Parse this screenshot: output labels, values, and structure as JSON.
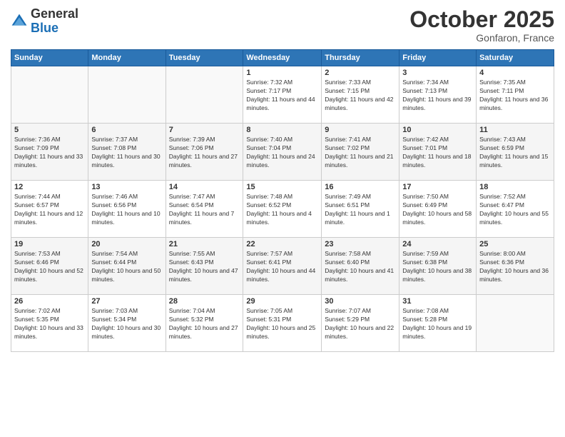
{
  "header": {
    "logo_general": "General",
    "logo_blue": "Blue",
    "month": "October 2025",
    "location": "Gonfaron, France"
  },
  "weekdays": [
    "Sunday",
    "Monday",
    "Tuesday",
    "Wednesday",
    "Thursday",
    "Friday",
    "Saturday"
  ],
  "weeks": [
    [
      {
        "day": "",
        "sunrise": "",
        "sunset": "",
        "daylight": ""
      },
      {
        "day": "",
        "sunrise": "",
        "sunset": "",
        "daylight": ""
      },
      {
        "day": "",
        "sunrise": "",
        "sunset": "",
        "daylight": ""
      },
      {
        "day": "1",
        "sunrise": "Sunrise: 7:32 AM",
        "sunset": "Sunset: 7:17 PM",
        "daylight": "Daylight: 11 hours and 44 minutes."
      },
      {
        "day": "2",
        "sunrise": "Sunrise: 7:33 AM",
        "sunset": "Sunset: 7:15 PM",
        "daylight": "Daylight: 11 hours and 42 minutes."
      },
      {
        "day": "3",
        "sunrise": "Sunrise: 7:34 AM",
        "sunset": "Sunset: 7:13 PM",
        "daylight": "Daylight: 11 hours and 39 minutes."
      },
      {
        "day": "4",
        "sunrise": "Sunrise: 7:35 AM",
        "sunset": "Sunset: 7:11 PM",
        "daylight": "Daylight: 11 hours and 36 minutes."
      }
    ],
    [
      {
        "day": "5",
        "sunrise": "Sunrise: 7:36 AM",
        "sunset": "Sunset: 7:09 PM",
        "daylight": "Daylight: 11 hours and 33 minutes."
      },
      {
        "day": "6",
        "sunrise": "Sunrise: 7:37 AM",
        "sunset": "Sunset: 7:08 PM",
        "daylight": "Daylight: 11 hours and 30 minutes."
      },
      {
        "day": "7",
        "sunrise": "Sunrise: 7:39 AM",
        "sunset": "Sunset: 7:06 PM",
        "daylight": "Daylight: 11 hours and 27 minutes."
      },
      {
        "day": "8",
        "sunrise": "Sunrise: 7:40 AM",
        "sunset": "Sunset: 7:04 PM",
        "daylight": "Daylight: 11 hours and 24 minutes."
      },
      {
        "day": "9",
        "sunrise": "Sunrise: 7:41 AM",
        "sunset": "Sunset: 7:02 PM",
        "daylight": "Daylight: 11 hours and 21 minutes."
      },
      {
        "day": "10",
        "sunrise": "Sunrise: 7:42 AM",
        "sunset": "Sunset: 7:01 PM",
        "daylight": "Daylight: 11 hours and 18 minutes."
      },
      {
        "day": "11",
        "sunrise": "Sunrise: 7:43 AM",
        "sunset": "Sunset: 6:59 PM",
        "daylight": "Daylight: 11 hours and 15 minutes."
      }
    ],
    [
      {
        "day": "12",
        "sunrise": "Sunrise: 7:44 AM",
        "sunset": "Sunset: 6:57 PM",
        "daylight": "Daylight: 11 hours and 12 minutes."
      },
      {
        "day": "13",
        "sunrise": "Sunrise: 7:46 AM",
        "sunset": "Sunset: 6:56 PM",
        "daylight": "Daylight: 11 hours and 10 minutes."
      },
      {
        "day": "14",
        "sunrise": "Sunrise: 7:47 AM",
        "sunset": "Sunset: 6:54 PM",
        "daylight": "Daylight: 11 hours and 7 minutes."
      },
      {
        "day": "15",
        "sunrise": "Sunrise: 7:48 AM",
        "sunset": "Sunset: 6:52 PM",
        "daylight": "Daylight: 11 hours and 4 minutes."
      },
      {
        "day": "16",
        "sunrise": "Sunrise: 7:49 AM",
        "sunset": "Sunset: 6:51 PM",
        "daylight": "Daylight: 11 hours and 1 minute."
      },
      {
        "day": "17",
        "sunrise": "Sunrise: 7:50 AM",
        "sunset": "Sunset: 6:49 PM",
        "daylight": "Daylight: 10 hours and 58 minutes."
      },
      {
        "day": "18",
        "sunrise": "Sunrise: 7:52 AM",
        "sunset": "Sunset: 6:47 PM",
        "daylight": "Daylight: 10 hours and 55 minutes."
      }
    ],
    [
      {
        "day": "19",
        "sunrise": "Sunrise: 7:53 AM",
        "sunset": "Sunset: 6:46 PM",
        "daylight": "Daylight: 10 hours and 52 minutes."
      },
      {
        "day": "20",
        "sunrise": "Sunrise: 7:54 AM",
        "sunset": "Sunset: 6:44 PM",
        "daylight": "Daylight: 10 hours and 50 minutes."
      },
      {
        "day": "21",
        "sunrise": "Sunrise: 7:55 AM",
        "sunset": "Sunset: 6:43 PM",
        "daylight": "Daylight: 10 hours and 47 minutes."
      },
      {
        "day": "22",
        "sunrise": "Sunrise: 7:57 AM",
        "sunset": "Sunset: 6:41 PM",
        "daylight": "Daylight: 10 hours and 44 minutes."
      },
      {
        "day": "23",
        "sunrise": "Sunrise: 7:58 AM",
        "sunset": "Sunset: 6:40 PM",
        "daylight": "Daylight: 10 hours and 41 minutes."
      },
      {
        "day": "24",
        "sunrise": "Sunrise: 7:59 AM",
        "sunset": "Sunset: 6:38 PM",
        "daylight": "Daylight: 10 hours and 38 minutes."
      },
      {
        "day": "25",
        "sunrise": "Sunrise: 8:00 AM",
        "sunset": "Sunset: 6:36 PM",
        "daylight": "Daylight: 10 hours and 36 minutes."
      }
    ],
    [
      {
        "day": "26",
        "sunrise": "Sunrise: 7:02 AM",
        "sunset": "Sunset: 5:35 PM",
        "daylight": "Daylight: 10 hours and 33 minutes."
      },
      {
        "day": "27",
        "sunrise": "Sunrise: 7:03 AM",
        "sunset": "Sunset: 5:34 PM",
        "daylight": "Daylight: 10 hours and 30 minutes."
      },
      {
        "day": "28",
        "sunrise": "Sunrise: 7:04 AM",
        "sunset": "Sunset: 5:32 PM",
        "daylight": "Daylight: 10 hours and 27 minutes."
      },
      {
        "day": "29",
        "sunrise": "Sunrise: 7:05 AM",
        "sunset": "Sunset: 5:31 PM",
        "daylight": "Daylight: 10 hours and 25 minutes."
      },
      {
        "day": "30",
        "sunrise": "Sunrise: 7:07 AM",
        "sunset": "Sunset: 5:29 PM",
        "daylight": "Daylight: 10 hours and 22 minutes."
      },
      {
        "day": "31",
        "sunrise": "Sunrise: 7:08 AM",
        "sunset": "Sunset: 5:28 PM",
        "daylight": "Daylight: 10 hours and 19 minutes."
      },
      {
        "day": "",
        "sunrise": "",
        "sunset": "",
        "daylight": ""
      }
    ]
  ]
}
